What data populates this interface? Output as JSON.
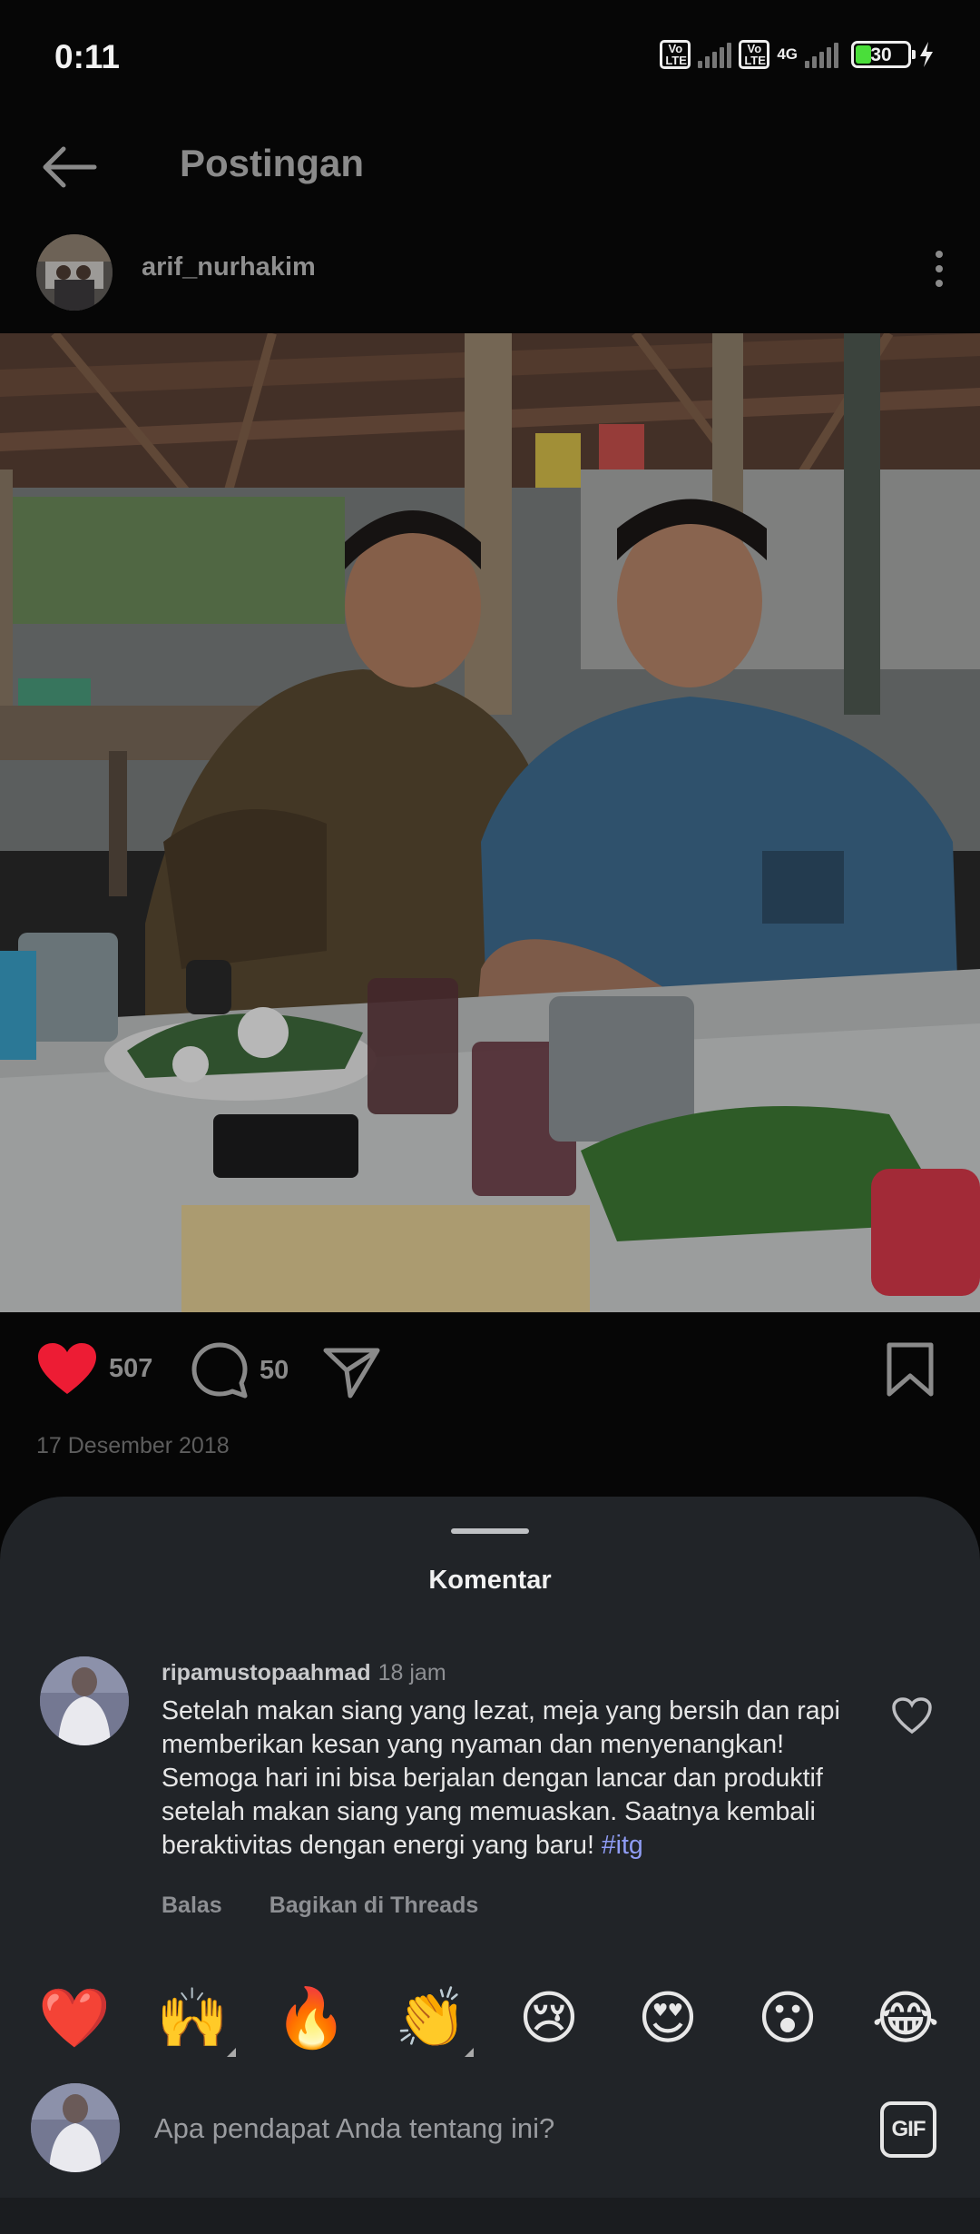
{
  "status_bar": {
    "time": "0:11",
    "volte_label": "Vo\nLTE",
    "network_label": "4G",
    "battery_level": "30",
    "charging": true
  },
  "header": {
    "title": "Postingan",
    "back_icon": "arrow-left-icon"
  },
  "post": {
    "author": "arif_nurhakim",
    "more_icon": "more-vertical-icon",
    "likes": "507",
    "comments": "50",
    "date": "17 Desember 2018",
    "icons": {
      "like": "heart-filled-icon",
      "comment": "comment-bubble-icon",
      "share": "send-icon",
      "save": "bookmark-icon"
    },
    "colors": {
      "like": "#ed1c34"
    }
  },
  "comments_sheet": {
    "title": "Komentar",
    "comment": {
      "username": "ripamustopaahmad",
      "time": "18 jam",
      "text": "Setelah makan siang yang lezat, meja yang bersih dan rapi memberikan kesan yang nyaman dan menyenangkan!  Semoga hari ini bisa berjalan dengan lancar dan produktif setelah makan siang yang memuaskan. Saatnya kembali beraktivitas dengan energi yang baru! ",
      "hashtag": "#itg",
      "reply_label": "Balas",
      "share_label": "Bagikan di Threads"
    },
    "emojis": [
      "❤️",
      "🙌",
      "🔥",
      "👏",
      "😢",
      "😍",
      "😮",
      "😂"
    ],
    "compose": {
      "placeholder": "Apa pendapat Anda tentang ini?",
      "gif_label": "GIF"
    }
  }
}
